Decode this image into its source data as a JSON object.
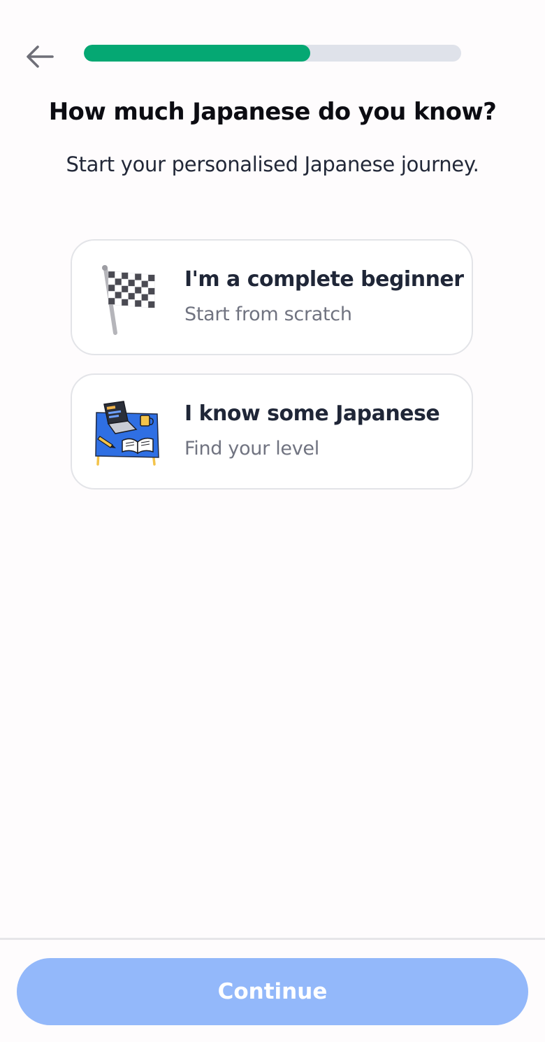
{
  "header": {
    "back_icon": "arrow-left-icon",
    "progress_fraction": 0.6
  },
  "question": {
    "title": "How much Japanese do you know?",
    "subtitle": "Start your personalised Japanese journey."
  },
  "options": [
    {
      "icon": "checkered-flag-icon",
      "title": "I'm a complete beginner",
      "subtitle": "Start from scratch"
    },
    {
      "icon": "study-desk-icon",
      "title": "I know some Japanese",
      "subtitle": "Find your level"
    }
  ],
  "footer": {
    "continue_label": "Continue"
  },
  "colors": {
    "progress_fill": "#05a873",
    "progress_track": "#dfe2ea",
    "continue_disabled": "#93b8fa",
    "desk_blue": "#2f6fe3"
  }
}
